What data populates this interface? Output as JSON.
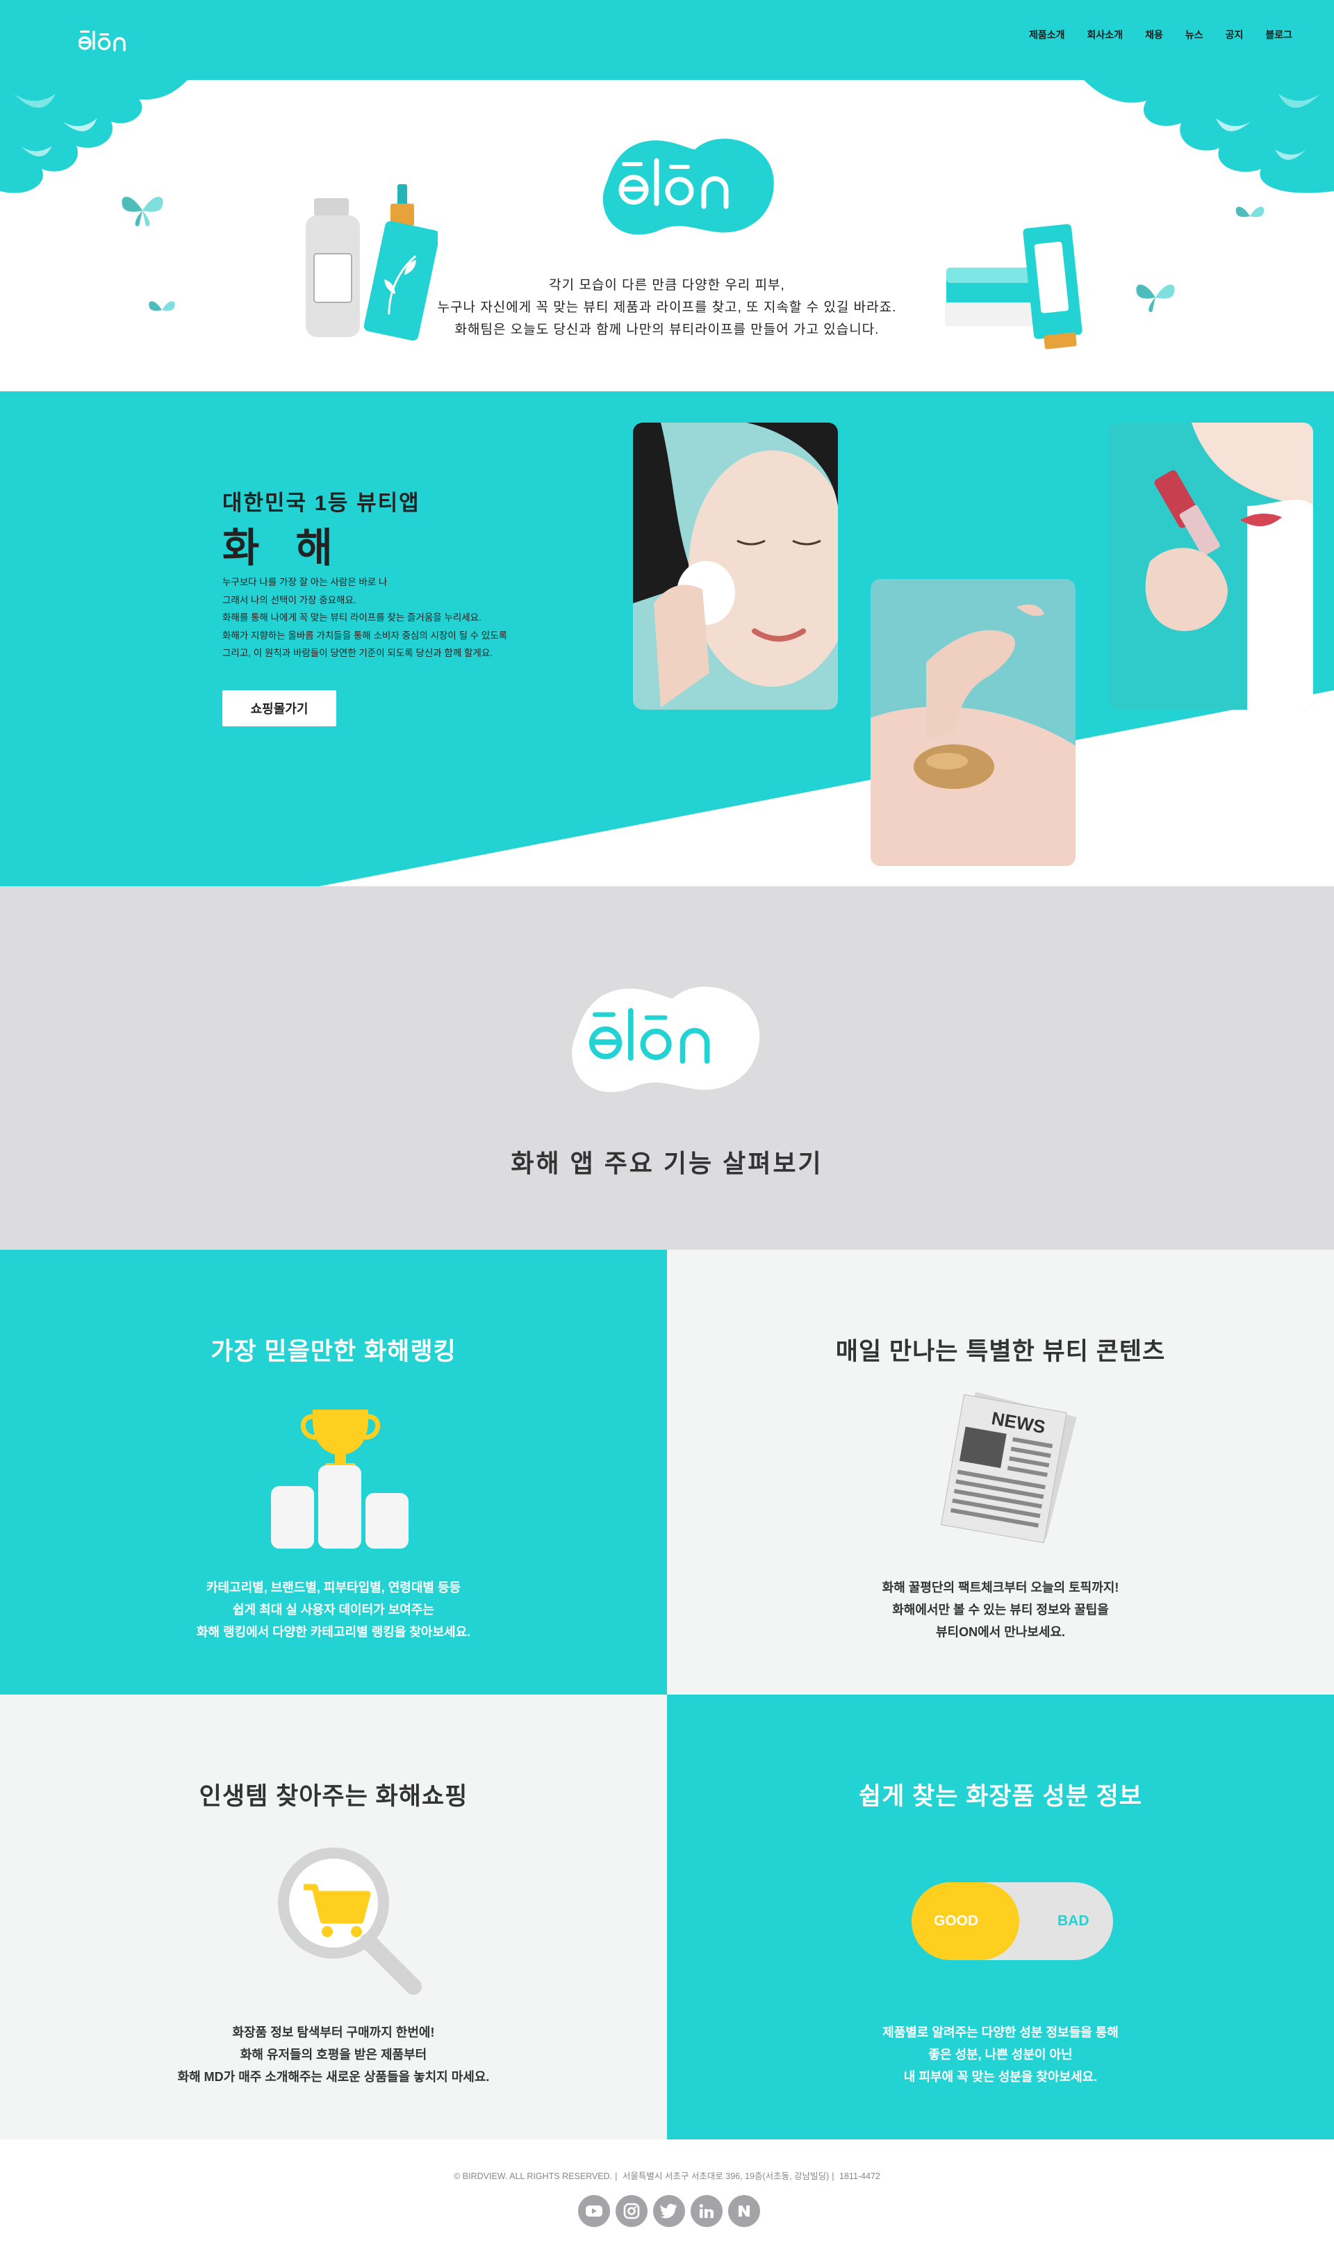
{
  "brand": {
    "logo_text": "ēlōn",
    "accent": "#23d3d3",
    "gray_bg": "#dcdcde",
    "light_bg": "#f3f5f4",
    "yellow": "#ffd000"
  },
  "nav": {
    "items": [
      {
        "label": "제품소개"
      },
      {
        "label": "회사소개"
      },
      {
        "label": "채용"
      },
      {
        "label": "뉴스"
      },
      {
        "label": "공지"
      },
      {
        "label": "블로그"
      }
    ]
  },
  "intro": {
    "lines": [
      "각기 모습이 다른 만큼 다양한 우리 피부,",
      "누구나 자신에게 꼭 맞는 뷰티 제품과 라이프를 찾고, 또 지속할 수 있길 바라죠.",
      "화해팀은 오늘도 당신과 함께 나만의 뷰티라이프를 만들어 가고 있습니다."
    ]
  },
  "hero": {
    "subtitle": "대한민국 1등 뷰티앱",
    "title": "화 해",
    "desc": [
      "누구보다 나를 가장 잘 아는 사람은 바로 나",
      "그래서 나의 선택이 가장 중요해요.",
      "화해를 통해 나에게 꼭 맞는 뷰티 라이프를 찾는 즐거움을 누리세요.",
      "화해가 지향하는 올바름 가치들을 통해 소비자 중심의 시장이 될 수 있도록",
      "그리고, 이 원칙과 바람들이 당연한 기준이 되도록 당신과 함께 할게요."
    ],
    "button_label": "쇼핑몰가기"
  },
  "features_intro": {
    "heading": "화해 앱 주요 기능 살펴보기"
  },
  "features": [
    {
      "title": "가장 믿을만한 화해랭킹",
      "lines": [
        "카테고리별, 브랜드별, 피부타입별, 연령대별 등등",
        "쉽게 최대 실 사용자 데이터가 보여주는",
        "화해 랭킹에서 다양한 카테고리별 랭킹을 찾아보세요."
      ]
    },
    {
      "title": "매일 만나는 특별한 뷰티 콘텐츠",
      "news_label": "NEWS",
      "lines": [
        "화해 꿀평단의 팩트체크부터 오늘의 토픽까지!",
        "화해에서만 볼 수 있는 뷰티 정보와 꿀팁을",
        "뷰티ON에서 만나보세요."
      ]
    },
    {
      "title": "인생템 찾아주는 화해쇼핑",
      "lines": [
        "화장품 정보 탐색부터 구매까지 한번에!",
        "화해 유저들의 호평을 받은 제품부터",
        "화해 MD가 매주 소개해주는 새로운 상품들을 놓치지 마세요."
      ]
    },
    {
      "title": "쉽게 찾는 화장품 성분 정보",
      "good_label": "GOOD",
      "bad_label": "BAD",
      "lines": [
        "제품별로 알려주는 다양한 성분 정보들을 통해",
        "좋은 성분, 나쁜 성분이 아닌",
        "내 피부에 꼭 맞는 성분을 찾아보세요."
      ]
    }
  ],
  "footer": {
    "copyright": "© BIRDVIEW. ALL RIGHTS RESERVED.",
    "address": "서울특별시 서초구 서초대로 396, 19층(서초동, 강남빌딩)",
    "phone": "1811-4472",
    "socials": [
      "youtube-icon",
      "instagram-icon",
      "twitter-icon",
      "linkedin-icon",
      "naver-icon"
    ]
  }
}
